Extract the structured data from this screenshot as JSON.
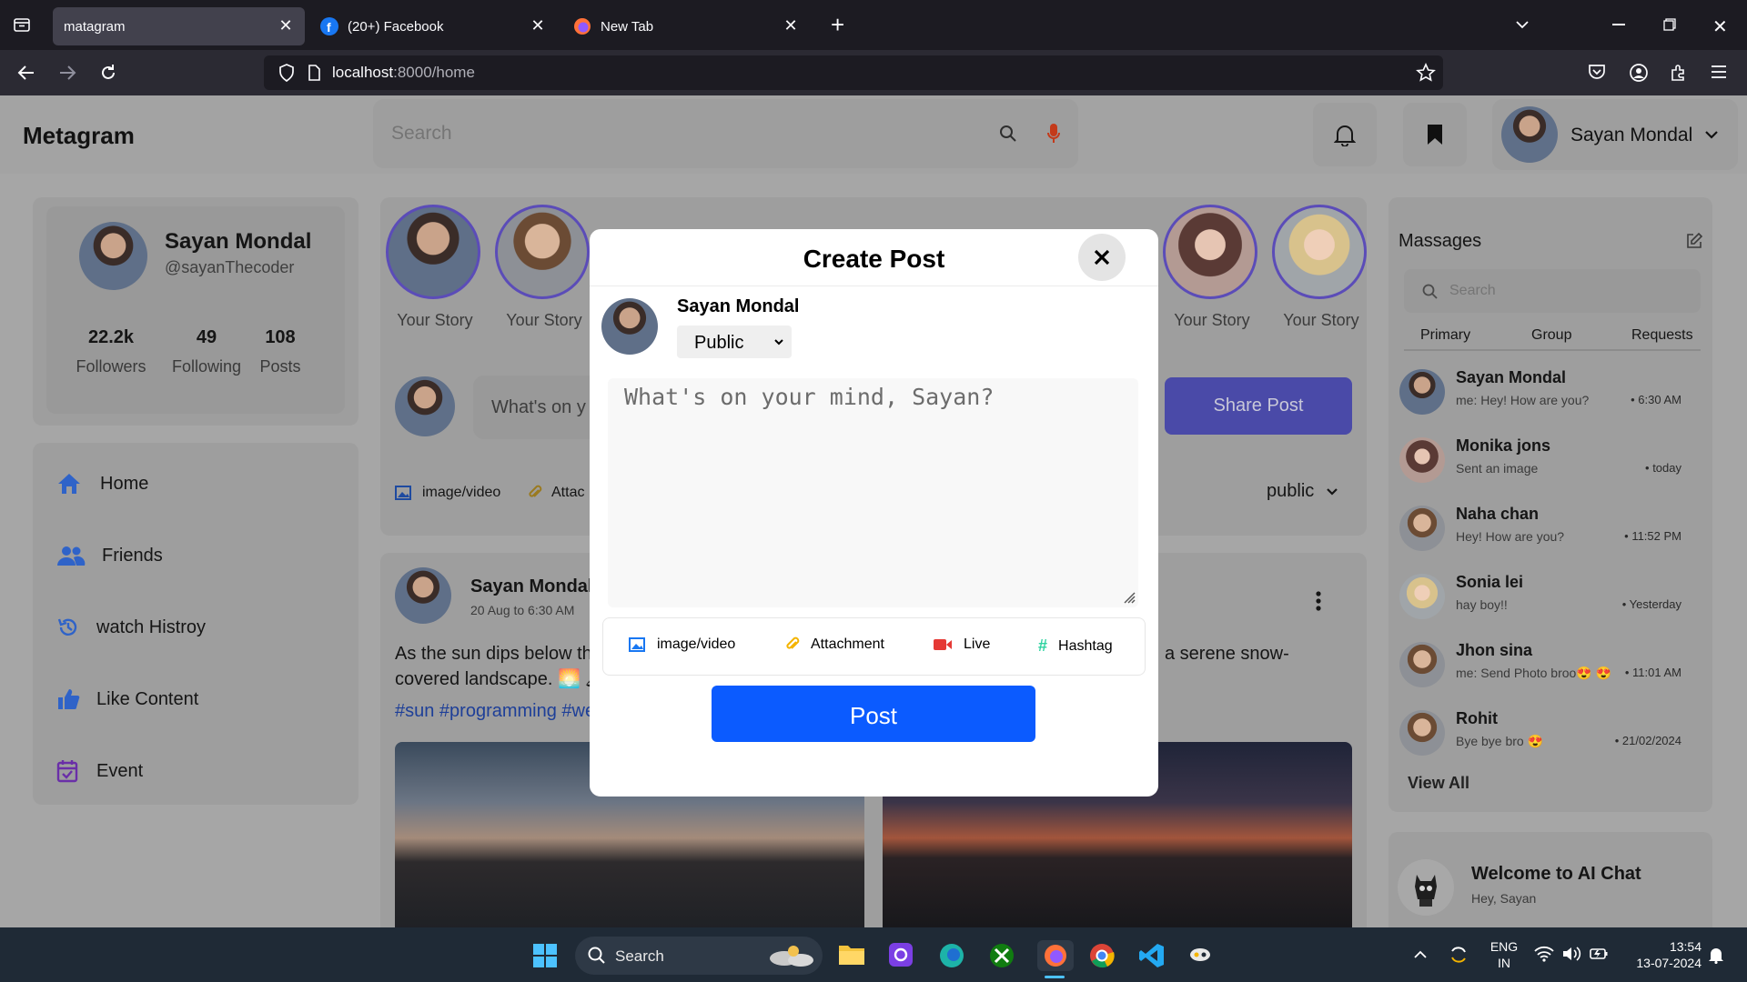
{
  "browser": {
    "tabs": [
      {
        "label": "matagram",
        "active": true
      },
      {
        "label": "(20+) Facebook",
        "active": false
      },
      {
        "label": "New Tab",
        "active": false
      }
    ],
    "url_host": "localhost",
    "url_rest": ":8000/home"
  },
  "app": {
    "brand": "Metagram",
    "search_placeholder": "Search",
    "user_name": "Sayan Mondal"
  },
  "profile": {
    "name": "Sayan Mondal",
    "handle": "@sayanThecoder",
    "stats": [
      {
        "value": "22.2k",
        "label": "Followers"
      },
      {
        "value": "49",
        "label": "Following"
      },
      {
        "value": "108",
        "label": "Posts"
      }
    ]
  },
  "nav": [
    {
      "label": "Home",
      "icon": "home-icon"
    },
    {
      "label": "Friends",
      "icon": "friends-icon"
    },
    {
      "label": "watch Histroy",
      "icon": "history-icon"
    },
    {
      "label": "Like Content",
      "icon": "thumbs-up-icon"
    },
    {
      "label": "Event",
      "icon": "calendar-icon"
    }
  ],
  "stories": {
    "label": "Your Story"
  },
  "composer": {
    "placeholder": "What's on y",
    "share_label": "Share Post",
    "media_label": "image/video",
    "attach_label": "Attac",
    "visibility": "public"
  },
  "feed_post": {
    "author": "Sayan Mondal",
    "time": "20 Aug to 6:30 AM",
    "text_left": "As the sun dips below th",
    "text_right": "a serene snow-",
    "text_line2": "covered landscape. 🌅 🏔",
    "hashtags": "#sun #programming #we"
  },
  "messages": {
    "title": "Massages",
    "search_placeholder": "Search",
    "tabs": [
      "Primary",
      "Group",
      "Requests"
    ],
    "items": [
      {
        "name": "Sayan Mondal",
        "preview": "me: Hey! How are you?",
        "time": "6:30 AM"
      },
      {
        "name": "Monika jons",
        "preview": "Sent an image",
        "time": "today"
      },
      {
        "name": "Naha chan",
        "preview": "Hey! How are you?",
        "time": "11:52 PM"
      },
      {
        "name": "Sonia lei",
        "preview": "hay boy!!",
        "time": "Yesterday"
      },
      {
        "name": "Jhon sina",
        "preview": "me: Send Photo broo😍 😍",
        "time": "11:01 AM"
      },
      {
        "name": "Rohit",
        "preview": "Bye bye bro 😍",
        "time": "21/02/2024"
      }
    ],
    "view_all": "View All"
  },
  "ai_chat": {
    "title": "Welcome to AI Chat",
    "subtitle": "Hey, Sayan"
  },
  "modal": {
    "title": "Create Post",
    "author": "Sayan Mondal",
    "visibility": "Public",
    "placeholder": "What's on your mind, Sayan?",
    "tools": [
      {
        "label": "image/video",
        "icon": "image-icon",
        "color": "#1877f2"
      },
      {
        "label": "Attachment",
        "icon": "paperclip-icon",
        "color": "#f4b400"
      },
      {
        "label": "Live",
        "icon": "video-camera-icon",
        "color": "#e53935"
      },
      {
        "label": "Hashtag",
        "icon": "hashtag-icon",
        "color": "#2ed3a0"
      }
    ],
    "post_label": "Post"
  },
  "taskbar": {
    "search_label": "Search",
    "lang_top": "ENG",
    "lang_bottom": "IN",
    "time": "13:54",
    "date": "13-07-2024"
  }
}
